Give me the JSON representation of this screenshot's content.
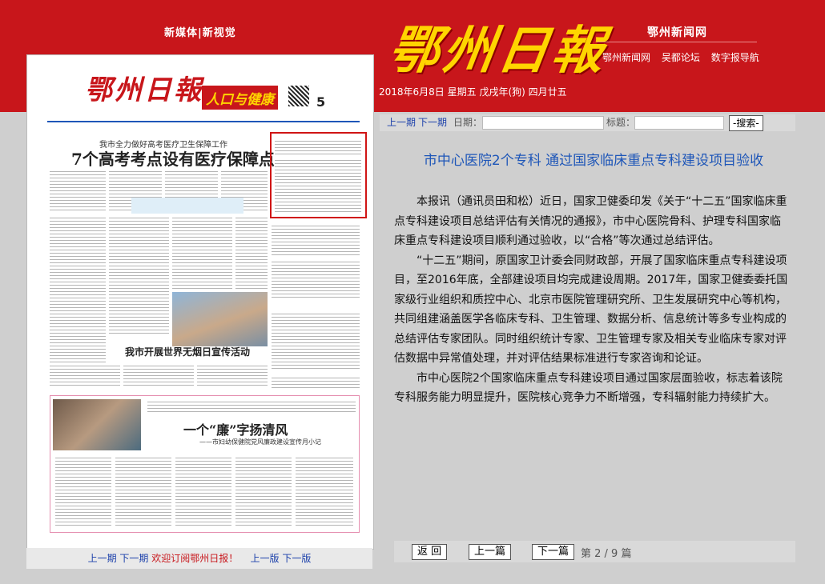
{
  "header": {
    "slogan": "新媒体|新视觉",
    "logo": "鄂州日報",
    "network_title": "鄂州新闻网",
    "network_links": [
      "鄂州新闻网",
      "吴都论坛",
      "数字报导航"
    ],
    "date": "2018年6月8日 星期五 戊戌年(狗) 四月廿五"
  },
  "paper": {
    "masthead": "鄂州日報",
    "page_number": "5",
    "page_title": "人口与健康",
    "headline_1": "7个高考考点设有医疗保障点",
    "headline_1_kicker": "我市全力做好高考医疗卫生保障工作",
    "headline_2": "我市开展世界无烟日宣传活动",
    "headline_3": "一个“廉”字扬清风",
    "headline_3_sub": "——市妇幼保健院党风廉政建设宣传月小记",
    "bottom_links": {
      "prev": "上一期",
      "next": "下一期",
      "welcome": "欢迎订阅鄂州日报！",
      "prev_page": "上一版",
      "next_page": "下一版"
    }
  },
  "toolbar": {
    "prev_issue": "上一期",
    "next_issue": "下一期",
    "date_label": "日期：",
    "title_label": "标题：",
    "search_button": "-搜索-"
  },
  "article": {
    "title": "市中心医院2个专科 通过国家临床重点专科建设项目验收",
    "paragraphs": [
      "本报讯（通讯员田和松）近日，国家卫健委印发《关于“十二五”国家临床重点专科建设项目总结评估有关情况的通报》，市中心医院骨科、护理专科国家临床重点专科建设项目顺利通过验收，以“合格”等次通过总结评估。",
      "“十二五”期间，原国家卫计委会同财政部，开展了国家临床重点专科建设项目，至2016年底，全部建设项目均完成建设周期。2017年，国家卫健委委托国家级行业组织和质控中心、北京市医院管理研究所、卫生发展研究中心等机构，共同组建涵盖医学各临床专科、卫生管理、数据分析、信息统计等多专业构成的总结评估专家团队。同时组织统计专家、卫生管理专家及相关专业临床专家对评估数据中异常值处理，并对评估结果标准进行专家咨询和论证。",
      "市中心医院2个国家临床重点专科建设项目通过国家层面验收，标志着该院专科服务能力明显提升，医院核心竞争力不断增强，专科辐射能力持续扩大。"
    ]
  },
  "pager": {
    "back": "返 回",
    "prev": "上一篇",
    "next": "下一篇",
    "page_info": "第 2 / 9 篇"
  }
}
